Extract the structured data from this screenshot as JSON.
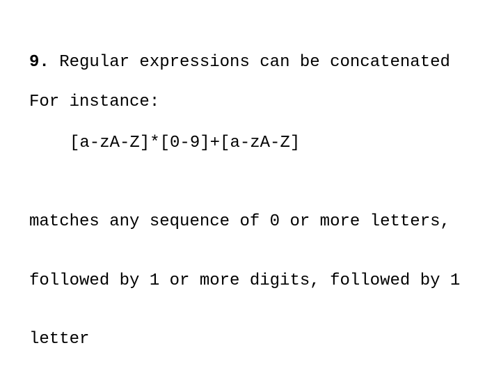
{
  "slide": {
    "heading": {
      "number": "9.",
      "text": " Regular expressions can be concatenated"
    },
    "intro": "For instance:",
    "regex_example": "[a-zA-Z]*[0-9]+[a-zA-Z]",
    "description_lines": [
      "matches any sequence of 0 or more letters,",
      "followed by 1 or more digits, followed by 1",
      "letter"
    ]
  }
}
